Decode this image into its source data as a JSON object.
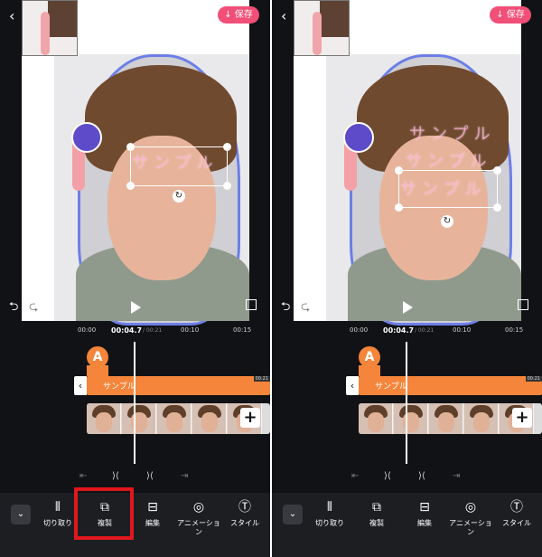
{
  "header": {
    "save_label": "↓ 保存"
  },
  "overlay": {
    "text": "サンプル"
  },
  "timeline": {
    "times": [
      "00:00",
      "00:04.7",
      "/ 00:21",
      "00:10",
      "00:15"
    ],
    "marker": "A",
    "track_label": "サンプル",
    "track_end": "00:21"
  },
  "toolbar": {
    "tools": [
      {
        "label": "切り取り"
      },
      {
        "label": "複製"
      },
      {
        "label": "編集"
      },
      {
        "label": "アニメーショ\nン"
      },
      {
        "label": "スタイル"
      }
    ]
  },
  "colors": {
    "accent": "#f4853a",
    "save": "#f04f78",
    "highlight": "#e0171e",
    "panel": "#111216"
  }
}
